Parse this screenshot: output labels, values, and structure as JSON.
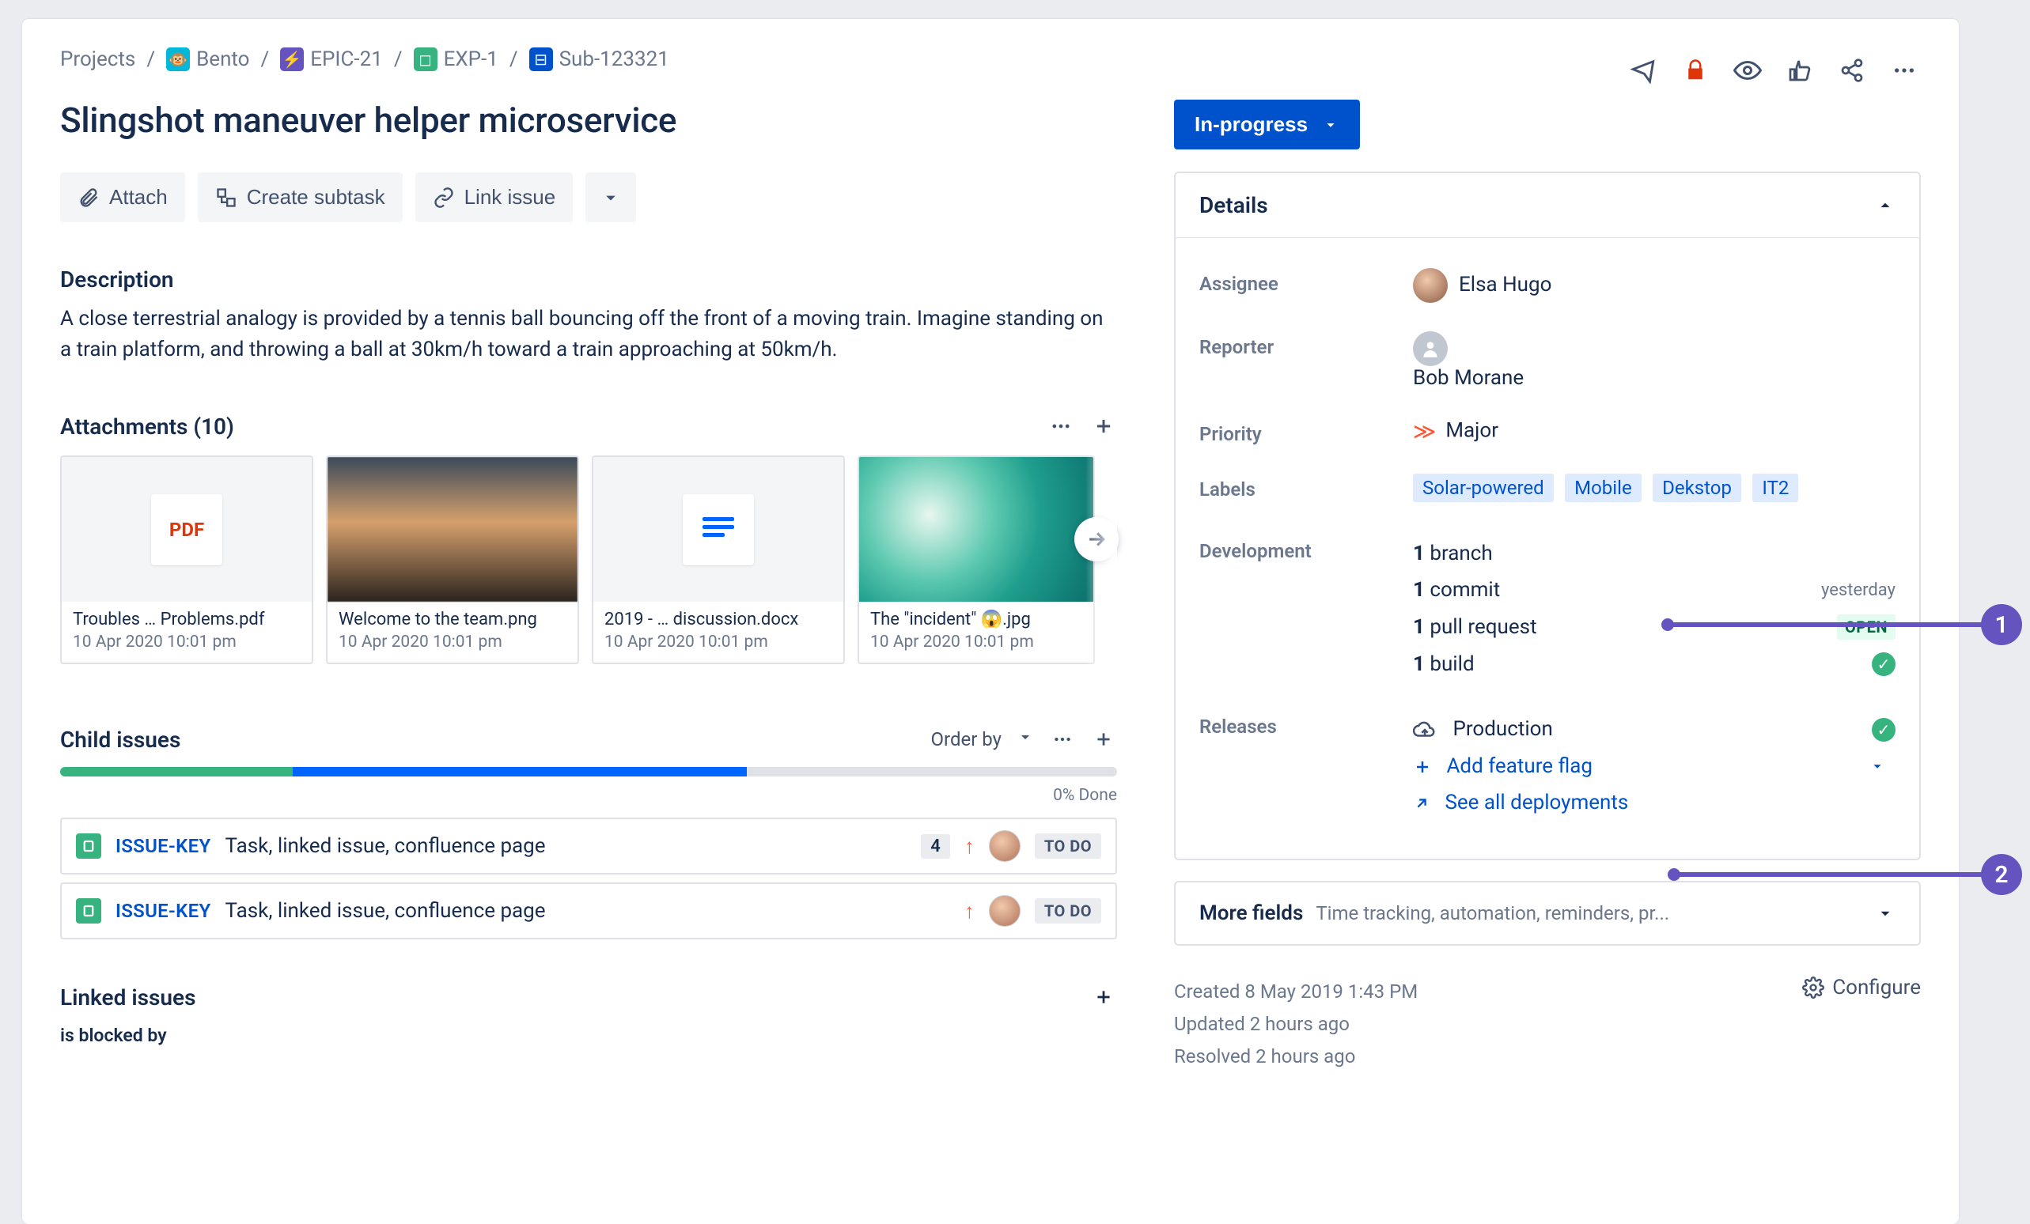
{
  "breadcrumb": {
    "root": "Projects",
    "items": [
      {
        "label": "Bento",
        "chip": "bento"
      },
      {
        "label": "EPIC-21",
        "chip": "epic"
      },
      {
        "label": "EXP-1",
        "chip": "exp"
      },
      {
        "label": "Sub-123321",
        "chip": "sub"
      }
    ]
  },
  "issue": {
    "title": "Slingshot maneuver helper microservice",
    "status": "In-progress"
  },
  "toolbar": {
    "attach": "Attach",
    "create_subtask": "Create subtask",
    "link_issue": "Link issue"
  },
  "description": {
    "heading": "Description",
    "body": "A close terrestrial analogy is provided by a tennis ball bouncing off the front of a moving train. Imagine standing on a train platform, and throwing a ball at 30km/h toward a train approaching at 50km/h."
  },
  "attachments": {
    "heading": "Attachments (10)",
    "items": [
      {
        "name": "Troubles … Problems.pdf",
        "date": "10 Apr 2020 10:01 pm",
        "kind": "pdf"
      },
      {
        "name": "Welcome to the team.png",
        "date": "10 Apr 2020 10:01 pm",
        "kind": "img1"
      },
      {
        "name": "2019 - … discussion.docx",
        "date": "10 Apr 2020 10:01 pm",
        "kind": "doc"
      },
      {
        "name": "The \"incident\" 😱.jpg",
        "date": "10 Apr 2020 10:01 pm",
        "kind": "img2"
      }
    ]
  },
  "child_issues": {
    "heading": "Child issues",
    "order_by": "Order by",
    "progress_label": "0% Done",
    "progress": {
      "green": 22,
      "blue": 43,
      "gray": 35
    },
    "rows": [
      {
        "key": "ISSUE-KEY",
        "title": "Task, linked issue, confluence page",
        "count": "4",
        "status": "TO DO",
        "show_count": true
      },
      {
        "key": "ISSUE-KEY",
        "title": "Task, linked issue, confluence page",
        "count": "",
        "status": "TO DO",
        "show_count": false
      }
    ]
  },
  "linked_issues": {
    "heading": "Linked issues",
    "relation": "is blocked by"
  },
  "details": {
    "heading": "Details",
    "assignee_label": "Assignee",
    "assignee": "Elsa Hugo",
    "reporter_label": "Reporter",
    "reporter": "Bob Morane",
    "priority_label": "Priority",
    "priority": "Major",
    "labels_label": "Labels",
    "labels": [
      "Solar-powered",
      "Mobile",
      "Dekstop",
      "IT2"
    ],
    "development_label": "Development",
    "development": {
      "branch": {
        "count": "1",
        "word": "branch"
      },
      "commit": {
        "count": "1",
        "word": "commit",
        "meta": "yesterday"
      },
      "pr": {
        "count": "1",
        "word": "pull request",
        "badge": "OPEN"
      },
      "build": {
        "count": "1",
        "word": "build",
        "check": true
      }
    },
    "releases_label": "Releases",
    "releases": {
      "name": "Production",
      "add_flag": "Add feature flag",
      "see_all": "See all deployments"
    }
  },
  "more_fields": {
    "title": "More fields",
    "hint": "Time tracking, automation, reminders, pr..."
  },
  "meta": {
    "created": "Created 8 May 2019 1:43 PM",
    "updated": "Updated 2 hours ago",
    "resolved": "Resolved 2 hours ago",
    "configure": "Configure"
  },
  "annotations": {
    "one": "1",
    "two": "2"
  }
}
